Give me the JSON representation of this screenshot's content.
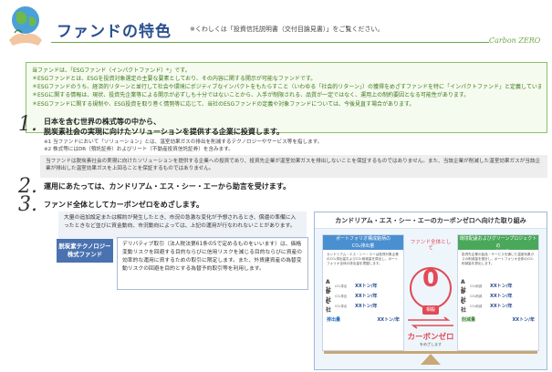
{
  "header": {
    "title": "ファンドの特色",
    "note": "※くわしくは「投資信託説明書（交付目論見書）」をご覧ください。",
    "brand": "Carbon ZERO"
  },
  "esg_box": {
    "lead": "当ファンドは、「ESGファンド（インパクトファンド）*」です。",
    "items": [
      "＊ESGファンドとは、ESGを投資対象選定の主要な要素としており、その内容に関する開示が可能なファンドです。",
      "＊ESGファンドのうち、経済的リターンと並行して社会や環境にポジティブなインパクトをもたらすこと（いわゆる「社会的リターン」）の獲得をめざすファンドを特に「インパクトファンド」と定義しています。",
      "＊ESGに関する情報は、現状、投資先企業等による開示が必ずしも十分ではないことから、入手が制限される、品質が一定ではなく、運用上の制約要因となる可能性があります。",
      "＊ESGファンドに関する規制や、ESG投資を取り巻く情勢等に応じて、当社のESGファンドの定義や対象ファンドについては、今後見直す場合があります。"
    ]
  },
  "points": [
    {
      "num": "1.",
      "title_line1": "日本を含む世界の株式等の中から、",
      "title_line2": "脱炭素社会の実現に向けたソリューションを提供する企業に投資します。"
    },
    {
      "num": "2.",
      "title_line1": "運用にあたっては、カンドリアム・エス・シー・エーから助言を受けます。"
    },
    {
      "num": "3.",
      "title_line1": "ファンド全体としてカーボンゼロをめざします。"
    }
  ],
  "notes1": [
    "※1 当ファンドにおいて「ソリューション」とは、温室効果ガスの排出を削減するテクノロジーやサービス等を指します。",
    "※2 株式等にはDR（預託証券）およびリート（不動産投資信託証券）を含みます。"
  ],
  "gray_text": "当ファンドは脱炭素社会の実現に向けたソリューションを提供する企業への投資であり、投資先企業が温室効果ガスを排出しないことを保証するものではありません。また、当該企業が削減した温室効果ガスが当該企業が排出した温室効果ガスを上回ることを保証するものではありません。",
  "risk_text": "大量の追加設定または解約が発生したとき、市況の急激な変化が予想されるとき、償還の準備に入ったときなど並びに資金動向、市況動向によっては、上記の運用が行なわれないことがあります。",
  "tech_badge": {
    "line1": "脱炭素テクノロジー",
    "line2": "株式ファンド"
  },
  "tech_text": "デリバティブ取引（法人税法第61条の5で定めるものをいいます）は、価格変動リスクを回避する目的ならびに信用リスクを減じる目的ならびに資産の効率的な運用に資するための取引に限定します。また、外貨建資産の為替変動リスクの回避を目的とする為替予約取引等を利用します。",
  "diagram": {
    "title": "カンドリアム・エス・シー・エーのカーボンゼロへ向けた取り組み",
    "left": {
      "head_line1": "ポートフォリオ構成銘柄の",
      "head_line2": "CO₂排出量",
      "desc": "カンドリアム・エス・シー・エーは投資対象企業のCO₂排出量およびCO₂削減量を算出し、ポートフォリオ全体の排出量を把握します。",
      "rows": [
        {
          "co": "A社",
          "lbl": "CO₂排出",
          "val": "XXトン/年"
        },
        {
          "co": "B社",
          "lbl": "CO₂排出",
          "val": "XXトン/年"
        },
        {
          "co": "C社",
          "lbl": "CO₂排出",
          "val": "XXトン/年"
        }
      ],
      "total_name": "排出量",
      "total_val": "XXトン/年"
    },
    "right": {
      "head_line1": "環境配慮およびグリーンプロジェクトの",
      "head_line2": "CO₂削減量",
      "desc": "投資先企業の製品・サービスを通じた温室効果ガスの削減量を推計し、ポートフォリオ全体のCO₂削減量を算出します。",
      "rows": [
        {
          "co": "A社",
          "lbl": "CO₂削減",
          "val": "XXトン/年"
        },
        {
          "co": "B社",
          "lbl": "CO₂削減",
          "val": "XXトン/年"
        },
        {
          "co": "C社",
          "lbl": "CO₂削減",
          "val": "XXトン/年"
        }
      ],
      "total_name": "削減量",
      "total_val": "XXトン/年"
    },
    "center_title": "ファンド全体として",
    "zero": "0",
    "offset": "相殺",
    "carbon_zero": "カーボンゼロ",
    "aim": "をめざします"
  },
  "colors": {
    "title_blue": "#2a4f8f",
    "accent_green": "#6fa843",
    "accent_red": "#e24a55",
    "badge_blue": "#4a72b0",
    "left_panel_head": "#4a8fd0",
    "right_panel_head": "#4aa85a"
  }
}
